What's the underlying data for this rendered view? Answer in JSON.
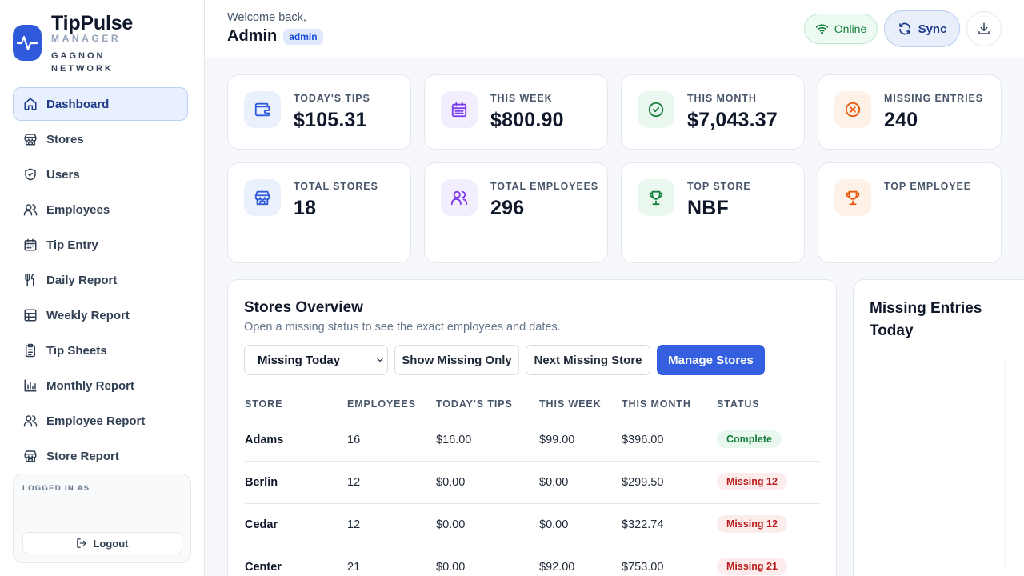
{
  "brand": {
    "name": "TipPulse",
    "sub": "MANAGER",
    "org": "GAGNON NETWORK"
  },
  "nav": [
    {
      "label": "Dashboard",
      "icon": "home-icon",
      "active": true
    },
    {
      "label": "Stores",
      "icon": "store-icon"
    },
    {
      "label": "Users",
      "icon": "shield-icon"
    },
    {
      "label": "Employees",
      "icon": "users-icon"
    },
    {
      "label": "Tip Entry",
      "icon": "calendar-icon"
    },
    {
      "label": "Daily Report",
      "icon": "utensils-icon"
    },
    {
      "label": "Weekly Report",
      "icon": "table-icon"
    },
    {
      "label": "Tip Sheets",
      "icon": "clipboard-icon"
    },
    {
      "label": "Monthly Report",
      "icon": "bar-chart-icon"
    },
    {
      "label": "Employee Report",
      "icon": "users-icon"
    },
    {
      "label": "Store Report",
      "icon": "store-icon"
    }
  ],
  "logged": {
    "label": "LOGGED IN AS",
    "logout": "Logout"
  },
  "header": {
    "welcome": "Welcome back,",
    "user": "Admin",
    "role": "admin",
    "status": "Online",
    "sync": "Sync"
  },
  "stats": [
    {
      "label": "TODAY'S TIPS",
      "value": "$105.31",
      "icon": "wallet-icon"
    },
    {
      "label": "THIS WEEK",
      "value": "$800.90",
      "icon": "calendar-icon"
    },
    {
      "label": "THIS MONTH",
      "value": "$7,043.37",
      "icon": "check-circle-icon"
    },
    {
      "label": "MISSING ENTRIES",
      "value": "240",
      "icon": "x-circle-icon"
    },
    {
      "label": "TOTAL STORES",
      "value": "18",
      "icon": "store-icon"
    },
    {
      "label": "TOTAL EMPLOYEES",
      "value": "296",
      "icon": "users-icon"
    },
    {
      "label": "TOP STORE",
      "value": "NBF",
      "icon": "trophy-icon"
    },
    {
      "label": "TOP EMPLOYEE",
      "value": "",
      "icon": "trophy-icon"
    }
  ],
  "overview": {
    "title": "Stores Overview",
    "subtitle": "Open a missing status to see the exact employees and dates.",
    "filter": "Missing Today",
    "buttons": {
      "show_missing": "Show Missing Only",
      "next_missing": "Next Missing Store",
      "manage": "Manage Stores"
    },
    "columns": [
      "STORE",
      "EMPLOYEES",
      "TODAY'S TIPS",
      "THIS WEEK",
      "THIS MONTH",
      "STATUS"
    ],
    "rows": [
      {
        "store": "Adams",
        "employees": "16",
        "today": "$16.00",
        "week": "$99.00",
        "month": "$396.00",
        "status": "Complete",
        "ok": true
      },
      {
        "store": "Berlin",
        "employees": "12",
        "today": "$0.00",
        "week": "$0.00",
        "month": "$299.50",
        "status": "Missing 12",
        "ok": false
      },
      {
        "store": "Cedar",
        "employees": "12",
        "today": "$0.00",
        "week": "$0.00",
        "month": "$322.74",
        "status": "Missing 12",
        "ok": false
      },
      {
        "store": "Center",
        "employees": "21",
        "today": "$0.00",
        "week": "$92.00",
        "month": "$753.00",
        "status": "Missing 21",
        "ok": false
      }
    ]
  },
  "missing_panel": {
    "title": "Missing Entries Today"
  },
  "colors": {
    "accent": "#3460e0",
    "success": "#15803d",
    "danger": "#b91c1c",
    "warning": "#ea580c"
  }
}
